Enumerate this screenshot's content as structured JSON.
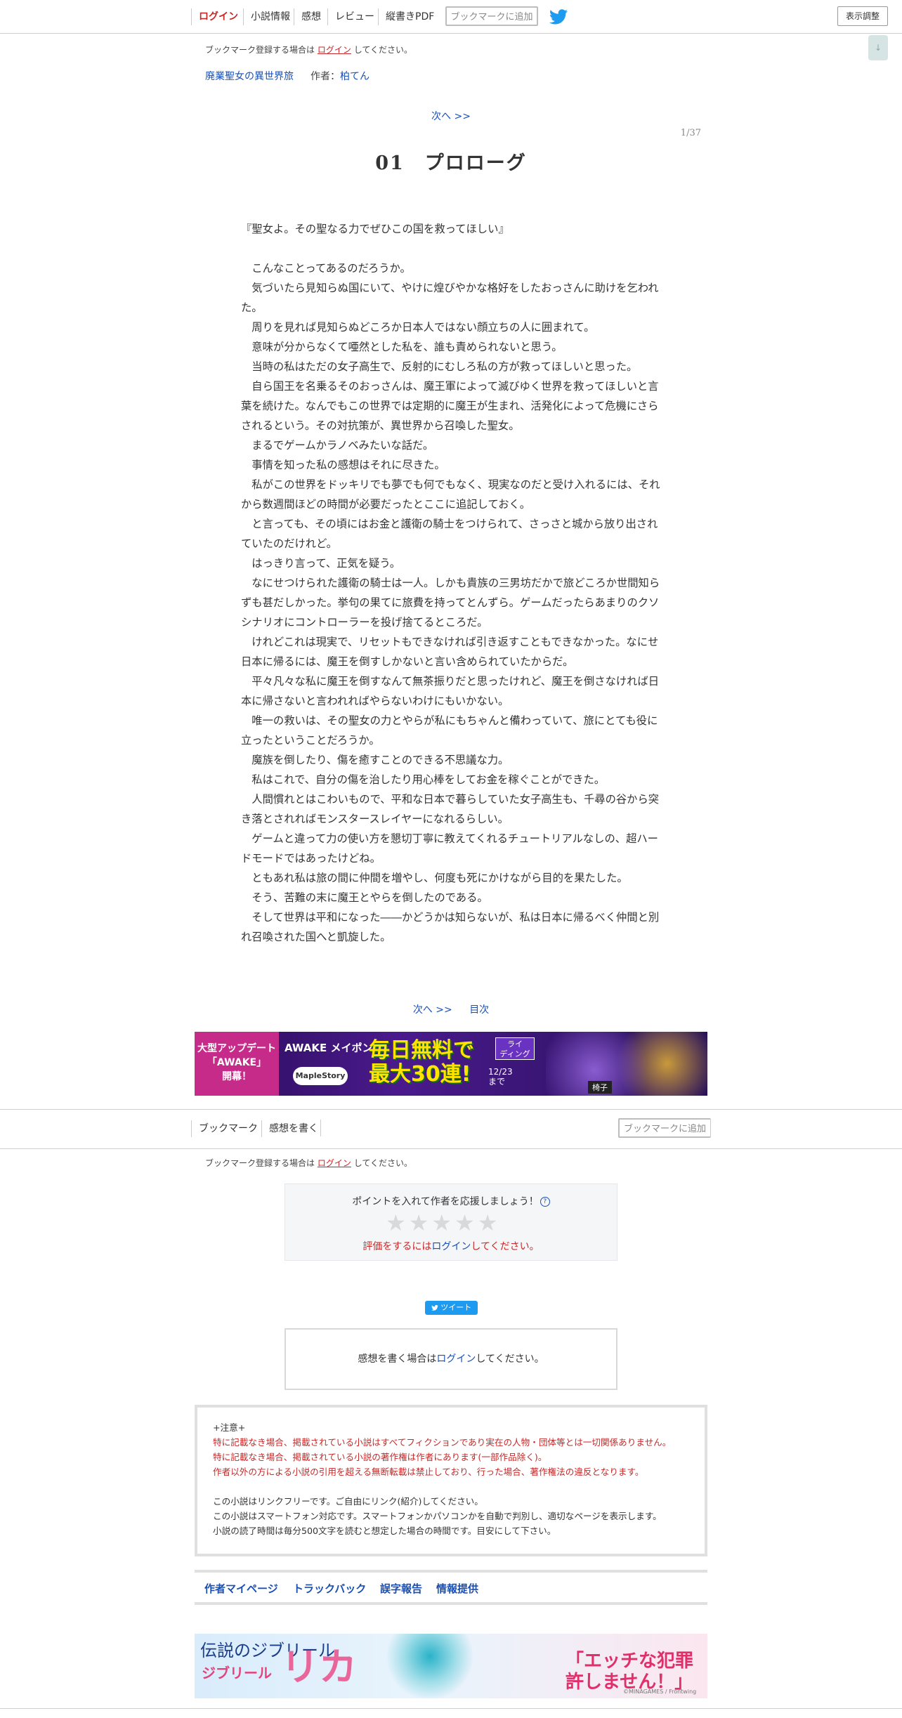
{
  "nav": {
    "items": [
      "ログイン",
      "小説情報",
      "感想",
      "レビュー",
      "縦書きPDF"
    ],
    "bookmark_button": "ブックマークに追加",
    "display_button": "表示調整",
    "scroll_button": "↓"
  },
  "bookmark_note": {
    "prefix": "ブックマーク登録する場合は",
    "link": "ログイン",
    "suffix": "してください。"
  },
  "novel": {
    "title": "廃業聖女の異世界旅",
    "author_label": "作者：",
    "author": "柏てん"
  },
  "pager": {
    "next": "次へ >>",
    "toc": "目次",
    "page": "1/37"
  },
  "chapter": {
    "title": "01　プロローグ",
    "paragraphs": [
      "『聖女よ。その聖なる力でぜひこの国を救ってほしい』",
      "",
      "　こんなことってあるのだろうか。",
      "　気づいたら見知らぬ国にいて、やけに煌びやかな格好をしたおっさんに助けを乞われた。",
      "　周りを見れば見知らぬどころか日本人ではない顔立ちの人に囲まれて。",
      "　意味が分からなくて唖然とした私を、誰も責められないと思う。",
      "　当時の私はただの女子高生で、反射的にむしろ私の方が救ってほしいと思った。",
      "　自ら国王を名乗るそのおっさんは、魔王軍によって滅びゆく世界を救ってほしいと言葉を続けた。なんでもこの世界では定期的に魔王が生まれ、活発化によって危機にさらされるという。その対抗策が、異世界から召喚した聖女。",
      "　まるでゲームかラノベみたいな話だ。",
      "　事情を知った私の感想はそれに尽きた。",
      "　私がこの世界をドッキリでも夢でも何でもなく、現実なのだと受け入れるには、それから数週間ほどの時間が必要だったとここに追記しておく。",
      "　と言っても、その頃にはお金と護衛の騎士をつけられて、さっさと城から放り出されていたのだけれど。",
      "　はっきり言って、正気を疑う。",
      "　なにせつけられた護衛の騎士は一人。しかも貴族の三男坊だかで旅どころか世間知らずも甚だしかった。挙句の果てに旅費を持ってとんずら。ゲームだったらあまりのクソシナリオにコントローラーを投げ捨てるところだ。",
      "　けれどこれは現実で、リセットもできなければ引き返すこともできなかった。なにせ日本に帰るには、魔王を倒すしかないと言い含められていたからだ。",
      "　平々凡々な私に魔王を倒すなんて無茶振りだと思ったけれど、魔王を倒さなければ日本に帰さないと言われればやらないわけにもいかない。",
      "　唯一の救いは、その聖女の力とやらが私にもちゃんと備わっていて、旅にとても役に立ったということだろうか。",
      "　魔族を倒したり、傷を癒すことのできる不思議な力。",
      "　私はこれで、自分の傷を治したり用心棒をしてお金を稼ぐことができた。",
      "　人間慣れとはこわいもので、平和な日本で暮らしていた女子高生も、千尋の谷から突き落とされればモンスタースレイヤーになれるらしい。",
      "　ゲームと違って力の使い方を懇切丁寧に教えてくれるチュートリアルなしの、超ハードモードではあったけどね。",
      "　ともあれ私は旅の間に仲間を増やし、何度も死にかけながら目的を果たした。",
      "　そう、苦難の末に魔王とやらを倒したのである。",
      "　そして世界は平和になった――かどうかは知らないが、私は日本に帰るべく仲間と別れ召喚された国へと凱旋した。"
    ]
  },
  "ad_top": {
    "left_text": "大型アップデート\n「AWAKE」\n開幕！",
    "brand": "AWAKE メイポン",
    "main": "毎日無料で\n最大30連!",
    "tag": "ライ\nディング",
    "date": "12/23\nまで",
    "logo": "MapleStory",
    "name_tag": "椅子"
  },
  "bar2": {
    "items": [
      "ブックマーク",
      "感想を書く"
    ],
    "bookmark_button": "ブックマークに追加"
  },
  "rating": {
    "prompt": "ポイントを入れて作者を応援しましょう！",
    "help": "?",
    "stars": "★★★★★",
    "requirement_prefix": "評価をするには",
    "requirement_link": "ログイン",
    "requirement_suffix": "してください。"
  },
  "tweet_button": "ツイート",
  "impression": {
    "prefix": "感想を書く場合は",
    "link": "ログイン",
    "suffix": "してください。"
  },
  "notice": {
    "heading": "+注意+",
    "red_lines": [
      "特に記載なき場合、掲載されている小説はすべてフィクションであり実在の人物・団体等とは一切関係ありません。",
      "特に記載なき場合、掲載されている小説の著作権は作者にあります(一部作品除く)。",
      "作者以外の方による小説の引用を超える無断転載は禁止しており、行った場合、著作権法の違反となります。"
    ],
    "lines": [
      "この小説はリンクフリーです。ご自由にリンク(紹介)してください。",
      "この小説はスマートフォン対応です。スマートフォンかパソコンかを自動で判別し、適切なページを表示します。",
      "小説の読了時間は毎分500文字を読むと想定した場合の時間です。目安にして下さい。"
    ]
  },
  "footer_links": [
    "作者マイページ",
    "トラックバック",
    "誤字報告",
    "情報提供"
  ],
  "ad_bottom": {
    "title": "伝説のジブリール",
    "logo": "ジブリール",
    "name": "リカ",
    "catch": "「エッチな犯罪\n許しません！」",
    "copyright": "©MINAGAMES / Frontwing"
  },
  "colors": {
    "link": "#1a4fb3",
    "login_red": "#c62828",
    "tweet_blue": "#1d9bf0"
  }
}
